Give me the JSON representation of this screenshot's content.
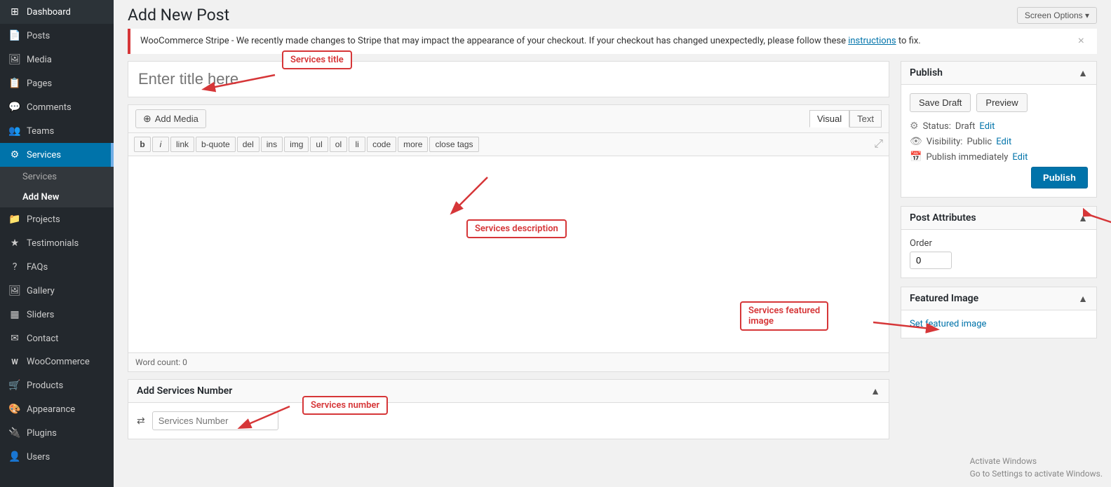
{
  "sidebar": {
    "items": [
      {
        "id": "dashboard",
        "label": "Dashboard",
        "icon": "⊞"
      },
      {
        "id": "posts",
        "label": "Posts",
        "icon": "📄"
      },
      {
        "id": "media",
        "label": "Media",
        "icon": "🖼"
      },
      {
        "id": "pages",
        "label": "Pages",
        "icon": "📋"
      },
      {
        "id": "comments",
        "label": "Comments",
        "icon": "💬"
      },
      {
        "id": "teams",
        "label": "Teams",
        "icon": "👥"
      },
      {
        "id": "services",
        "label": "Services",
        "icon": "⚙",
        "active": true
      },
      {
        "id": "projects",
        "label": "Projects",
        "icon": "📁"
      },
      {
        "id": "testimonials",
        "label": "Testimonials",
        "icon": "★"
      },
      {
        "id": "faqs",
        "label": "FAQs",
        "icon": "?"
      },
      {
        "id": "gallery",
        "label": "Gallery",
        "icon": "🖼"
      },
      {
        "id": "sliders",
        "label": "Sliders",
        "icon": "▦"
      },
      {
        "id": "contact",
        "label": "Contact",
        "icon": "✉"
      },
      {
        "id": "woocommerce",
        "label": "WooCommerce",
        "icon": "W"
      },
      {
        "id": "products",
        "label": "Products",
        "icon": "🛒"
      },
      {
        "id": "appearance",
        "label": "Appearance",
        "icon": "🎨"
      },
      {
        "id": "plugins",
        "label": "Plugins",
        "icon": "🔌"
      },
      {
        "id": "users",
        "label": "Users",
        "icon": "👤"
      }
    ],
    "services_sub": [
      {
        "id": "services-list",
        "label": "Services"
      },
      {
        "id": "services-add",
        "label": "Add New",
        "active": true
      }
    ]
  },
  "topbar": {
    "page_title": "Add New Post",
    "screen_options": "Screen Options ▾"
  },
  "notice": {
    "text": "WooCommerce Stripe - We recently made changes to Stripe that may impact the appearance of your checkout. If your checkout has changed unexpectedly, please follow these",
    "link_text": "instructions",
    "text_end": "to fix.",
    "close_label": "×"
  },
  "editor": {
    "title_placeholder": "Enter title here",
    "add_media_label": "Add Media",
    "tab_visual": "Visual",
    "tab_text": "Text",
    "toolbar": {
      "buttons": [
        "b",
        "i",
        "link",
        "b-quote",
        "del",
        "ins",
        "img",
        "ul",
        "ol",
        "li",
        "code",
        "more",
        "close tags"
      ]
    },
    "word_count": "Word count: 0"
  },
  "annotations": {
    "services_title": "Services title",
    "services_description": "Services description",
    "services_featured_image": "Services featured\nimage",
    "services_number": "Services number"
  },
  "services_number_box": {
    "header": "Add Services Number",
    "input_placeholder": "Services Number"
  },
  "publish_panel": {
    "header": "Publish",
    "save_draft": "Save Draft",
    "preview": "Preview",
    "status_label": "Status:",
    "status_value": "Draft",
    "status_edit": "Edit",
    "visibility_label": "Visibility:",
    "visibility_value": "Public",
    "visibility_edit": "Edit",
    "publish_label": "Publish immediately",
    "publish_edit": "Edit",
    "publish_btn": "Publish"
  },
  "post_attributes_panel": {
    "header": "Post Attributes",
    "order_label": "Order",
    "order_value": "0"
  },
  "featured_image_panel": {
    "header": "Featured Image",
    "set_link": "Set featured image"
  },
  "activate_windows": {
    "line1": "Activate Windows",
    "line2": "Go to Settings to activate Windows."
  }
}
